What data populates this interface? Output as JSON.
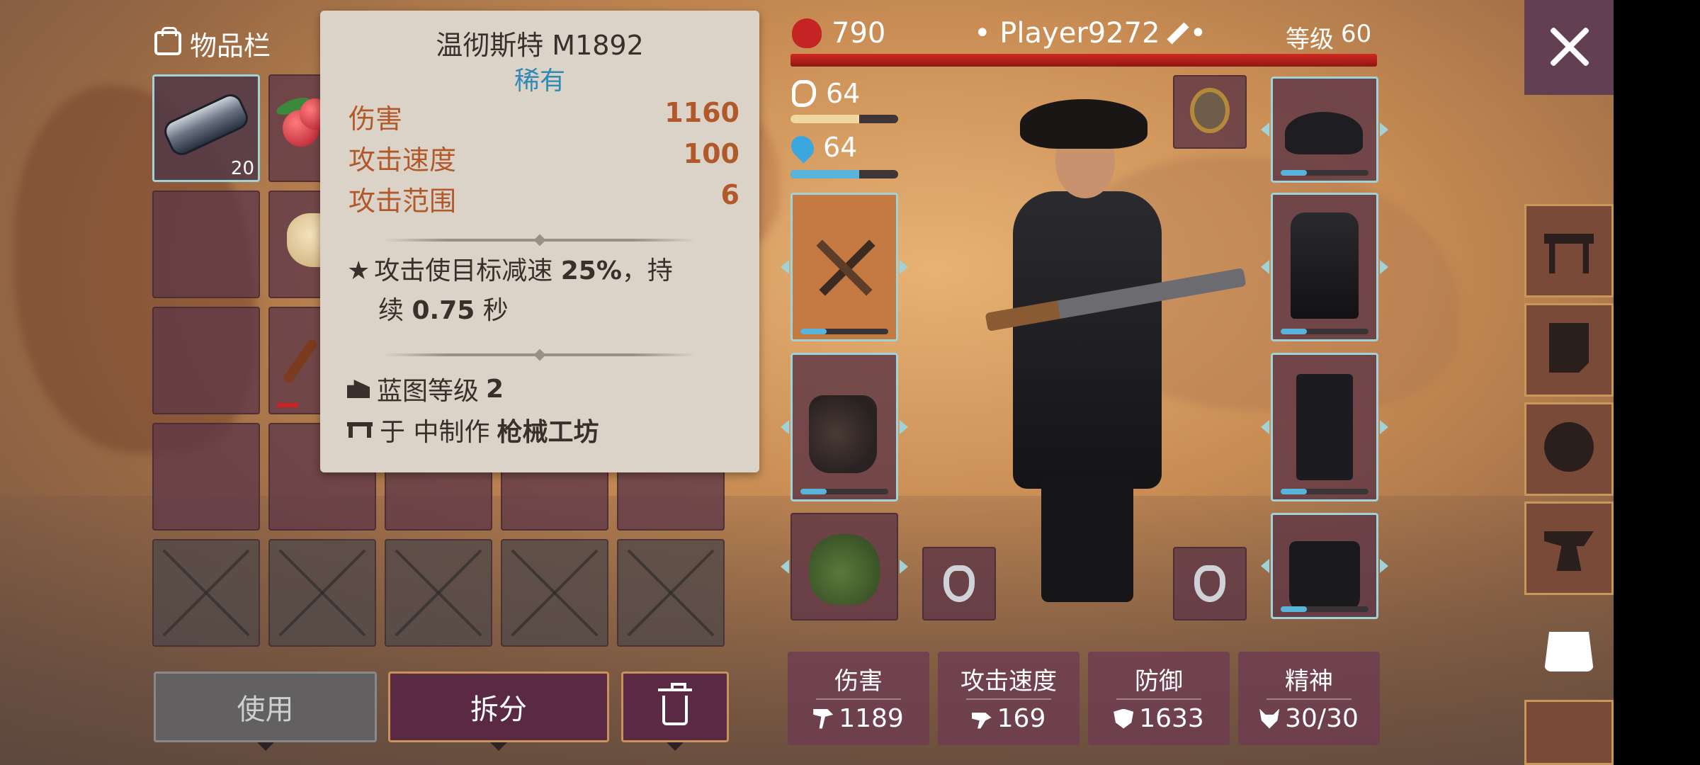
{
  "inventory": {
    "title": "物品栏",
    "slots": [
      {
        "item": "pipe-bomb",
        "count": "20",
        "selected": true
      },
      {
        "item": "berries",
        "count": ""
      },
      {
        "item": "",
        "count": ""
      },
      {
        "item": "",
        "count": ""
      },
      {
        "item": "",
        "count": ""
      },
      {
        "item": "",
        "count": ""
      },
      {
        "item": "cloth",
        "count": ""
      },
      {
        "item": "",
        "count": ""
      },
      {
        "item": "",
        "count": ""
      },
      {
        "item": "",
        "count": ""
      },
      {
        "item": "",
        "count": ""
      },
      {
        "item": "stick",
        "count": ""
      }
    ]
  },
  "tooltip": {
    "name": "温彻斯特 M1892",
    "rarity": "稀有",
    "rarity_color": "#2f8ab5",
    "stats": [
      {
        "label": "伤害",
        "value": "1160"
      },
      {
        "label": "攻击速度",
        "value": "100"
      },
      {
        "label": "攻击范围",
        "value": "6"
      }
    ],
    "effect_a": "攻击使目标减速",
    "effect_pct": "25%",
    "effect_b": "，持",
    "effect_c": "续",
    "effect_dur": "0.75",
    "effect_unit": "秒",
    "blueprint_label": "蓝图等级",
    "blueprint_level": "2",
    "craft_label": "于 中制作",
    "craft_station": "枪械工坊"
  },
  "buttons": {
    "use": "使用",
    "split": "拆分"
  },
  "player": {
    "hp": "790",
    "name": "• Player9272",
    "dot": "•",
    "level_label": "等级",
    "level": "60",
    "hunger": "64",
    "hunger_fill": 0.64,
    "thirst": "64",
    "thirst_fill": 0.64
  },
  "stats": [
    {
      "label": "伤害",
      "value": "1189",
      "icon": "axe-icon"
    },
    {
      "label": "攻击速度",
      "value": "169",
      "icon": "speed-icon"
    },
    {
      "label": "防御",
      "value": "1633",
      "icon": "shield-icon"
    },
    {
      "label": "精神",
      "value": "30/30",
      "icon": "wolf-icon"
    }
  ],
  "colors": {
    "accent_orange": "#b1592a",
    "health_red": "#c42424",
    "hunger_bar": "#f0d7a0",
    "thirst_bar": "#59b4dc"
  }
}
